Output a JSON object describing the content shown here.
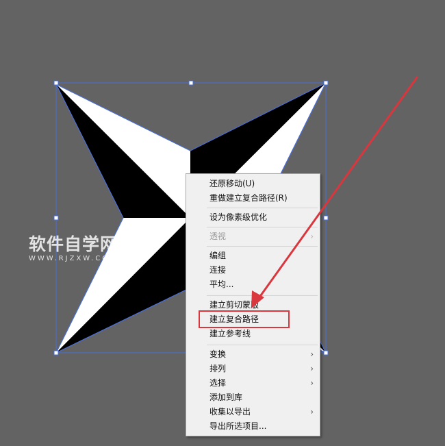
{
  "watermark": {
    "main": "软件自学网",
    "sub": "WWW.RJZXW.COM"
  },
  "context_menu": {
    "items": [
      {
        "label": "还原移动(U)",
        "submenu": false,
        "enabled": true
      },
      {
        "label": "重做建立复合路径(R)",
        "submenu": false,
        "enabled": true
      },
      {
        "label": "设为像素级优化",
        "submenu": false,
        "enabled": true
      },
      {
        "label": "透视",
        "submenu": true,
        "enabled": false
      },
      {
        "label": "编组",
        "submenu": false,
        "enabled": true
      },
      {
        "label": "连接",
        "submenu": false,
        "enabled": true
      },
      {
        "label": "平均...",
        "submenu": false,
        "enabled": true
      },
      {
        "label": "建立剪切蒙版",
        "submenu": false,
        "enabled": true
      },
      {
        "label": "建立复合路径",
        "submenu": false,
        "enabled": true,
        "highlighted": true
      },
      {
        "label": "建立参考线",
        "submenu": false,
        "enabled": true
      },
      {
        "label": "变换",
        "submenu": true,
        "enabled": true
      },
      {
        "label": "排列",
        "submenu": true,
        "enabled": true
      },
      {
        "label": "选择",
        "submenu": true,
        "enabled": true
      },
      {
        "label": "添加到库",
        "submenu": false,
        "enabled": true
      },
      {
        "label": "收集以导出",
        "submenu": true,
        "enabled": true
      },
      {
        "label": "导出所选项目...",
        "submenu": false,
        "enabled": true
      }
    ],
    "submenu_arrow": "›"
  },
  "colors": {
    "canvas_bg": "#636363",
    "selection": "#4a6fd8",
    "annotation_red": "#d9363e",
    "star_dark": "#000000",
    "star_light": "#ffffff"
  }
}
